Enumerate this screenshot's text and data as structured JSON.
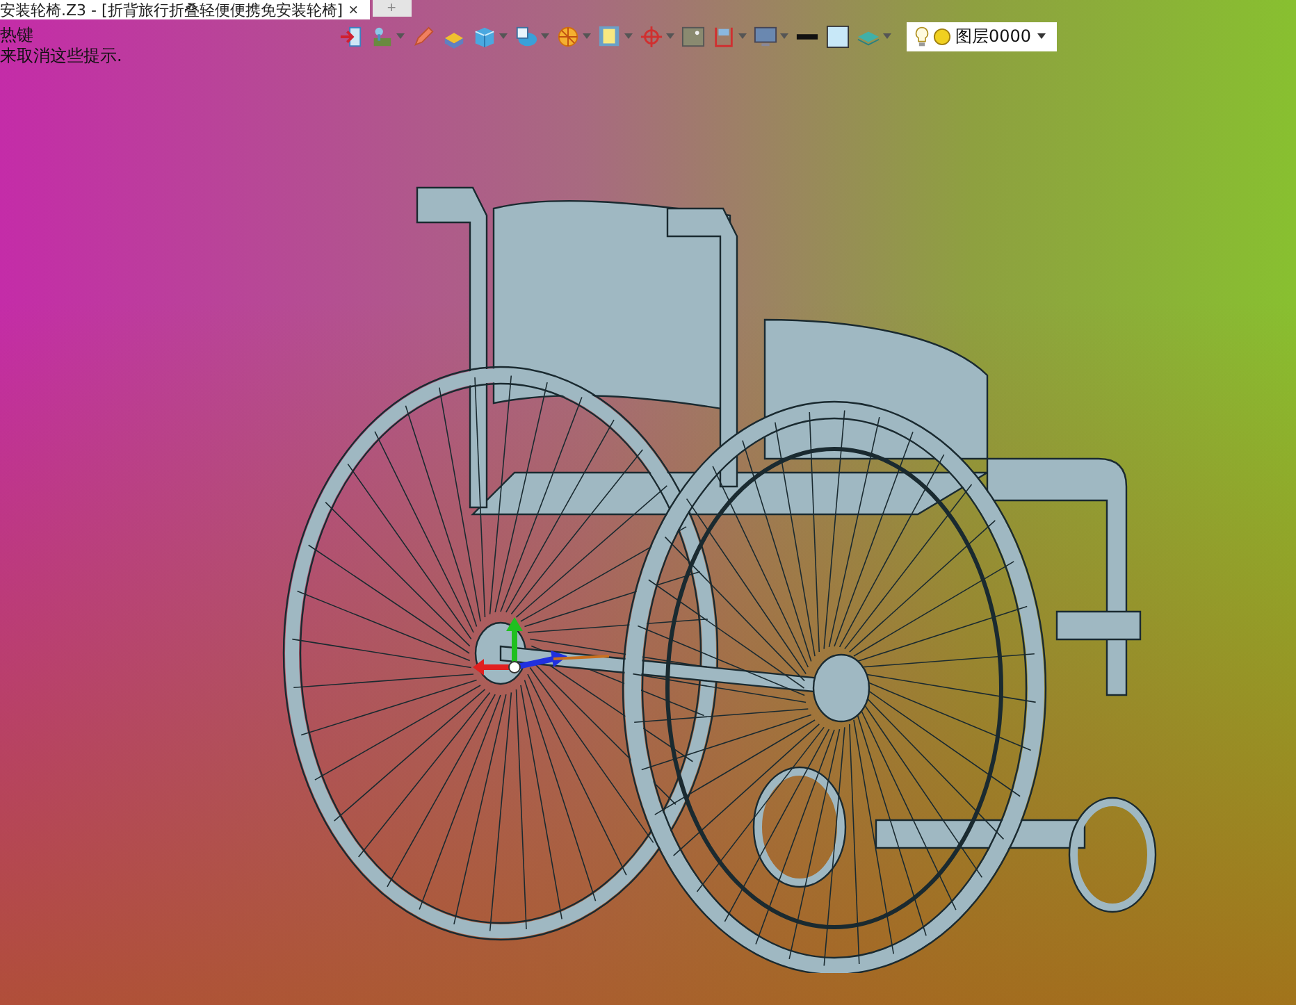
{
  "document_tab": {
    "title": "安装轮椅.Z3 - [折背旅行折叠轻便便携免安装轮椅]",
    "close": "×"
  },
  "new_tab": "+",
  "hints": [
    "热键",
    "来取消这些提示."
  ],
  "toolbar": [
    {
      "kind": "exit",
      "dropdown": false
    },
    {
      "kind": "tool",
      "dropdown": true
    },
    {
      "kind": "pencil",
      "dropdown": false
    },
    {
      "kind": "block",
      "dropdown": false
    },
    {
      "kind": "cube",
      "dropdown": true
    },
    {
      "kind": "view",
      "dropdown": true
    },
    {
      "kind": "pie",
      "dropdown": true
    },
    {
      "kind": "zoom",
      "dropdown": true
    },
    {
      "kind": "target",
      "dropdown": true
    },
    {
      "kind": "image",
      "dropdown": false
    },
    {
      "kind": "frame",
      "dropdown": true
    },
    {
      "kind": "monitor",
      "dropdown": true
    },
    {
      "kind": "line",
      "dropdown": false
    },
    {
      "kind": "square",
      "dropdown": false
    },
    {
      "kind": "layers",
      "dropdown": true
    }
  ],
  "layer_select": {
    "value": "图层0000"
  }
}
